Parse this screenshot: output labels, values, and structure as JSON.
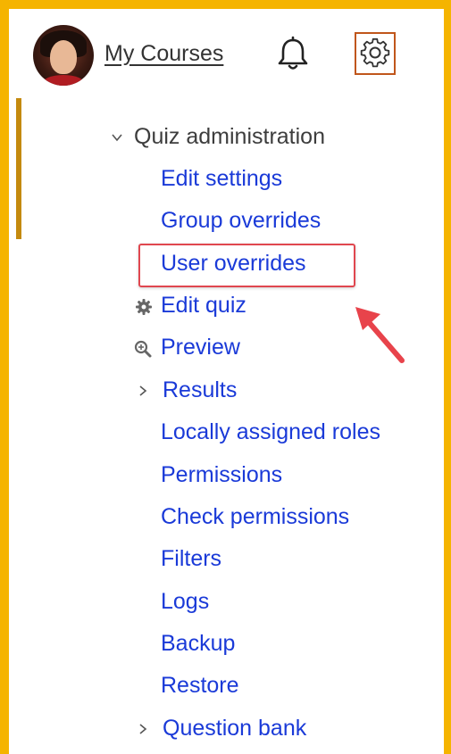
{
  "header": {
    "courses_link": "My Courses"
  },
  "menu": {
    "heading": "Quiz administration",
    "items": [
      {
        "label": "Edit settings"
      },
      {
        "label": "Group overrides"
      },
      {
        "label": "User overrides"
      },
      {
        "label": "Edit quiz"
      },
      {
        "label": "Preview"
      },
      {
        "label": "Results"
      },
      {
        "label": "Locally assigned roles"
      },
      {
        "label": "Permissions"
      },
      {
        "label": "Check permissions"
      },
      {
        "label": "Filters"
      },
      {
        "label": "Logs"
      },
      {
        "label": "Backup"
      },
      {
        "label": "Restore"
      },
      {
        "label": "Question bank"
      }
    ]
  },
  "colors": {
    "border": "#f5b400",
    "link": "#1a3ad8",
    "highlight": "#e0474f",
    "gear_box": "#c0561b"
  },
  "icons": {
    "avatar": "user-avatar",
    "bell": "bell-icon",
    "gear": "gear-icon",
    "edit_quiz": "cog-icon",
    "preview": "magnifier-icon",
    "expand": "chevron-right-icon",
    "collapse": "chevron-down-icon",
    "annotation": "red-arrow"
  }
}
